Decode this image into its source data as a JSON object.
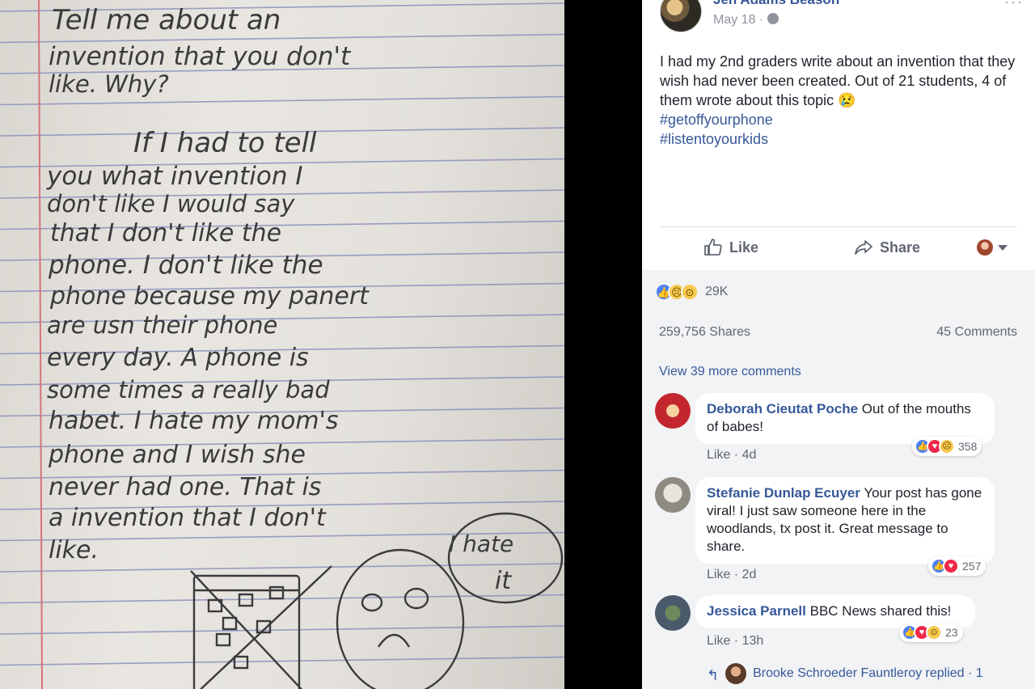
{
  "photo": {
    "handwriting": [
      "Tell me about an",
      "invention that you don't",
      "like. Why?",
      "If I had to tell",
      "you what invention I",
      "don't like I would say",
      "that I don't like the",
      "phone. I don't like the",
      "phone because my panert",
      "are usn their phone",
      "every day. A phone is",
      "some times a really bad",
      "habet. I hate my mom's",
      "phone and I wish she",
      "never had one. That is",
      "a invention that I don't",
      "like."
    ],
    "bubble_text": [
      "I hate",
      "it"
    ]
  },
  "post": {
    "author": "Jen Adams Beason",
    "date": "May 18",
    "more_label": "···",
    "text": "I had my 2nd graders write about an invention that they wish had never been created. Out of 21 students, 4 of them wrote about this topic 😢",
    "hashtags": [
      "#getoffyourphone",
      "#listentoyourkids"
    ]
  },
  "actions": {
    "like_label": "Like",
    "share_label": "Share"
  },
  "stats": {
    "reactions_count": "29K",
    "shares": "259,756 Shares",
    "comments": "45 Comments",
    "view_more": "View 39 more comments"
  },
  "comments": [
    {
      "name": "Deborah Cieutat Poche",
      "text": "Out of the mouths of babes!",
      "like_label": "Like",
      "time": "4d",
      "reaction_count": "358"
    },
    {
      "name": "Stefanie Dunlap Ecuyer",
      "text": "Your post has gone viral! I just saw someone here in the woodlands, tx post it. Great message to share.",
      "like_label": "Like",
      "time": "2d",
      "reaction_count": "257"
    },
    {
      "name": "Jessica Parnell",
      "text": "BBC News shared this!",
      "like_label": "Like",
      "time": "13h",
      "reaction_count": "23"
    }
  ],
  "reply": {
    "text": "Brooke Schroeder Fauntleroy replied · 1"
  },
  "colors": {
    "link_blue": "#365899",
    "like_blue": "#4a80f5",
    "love_red": "#f0284a",
    "panel_gray": "#f2f3f5"
  }
}
